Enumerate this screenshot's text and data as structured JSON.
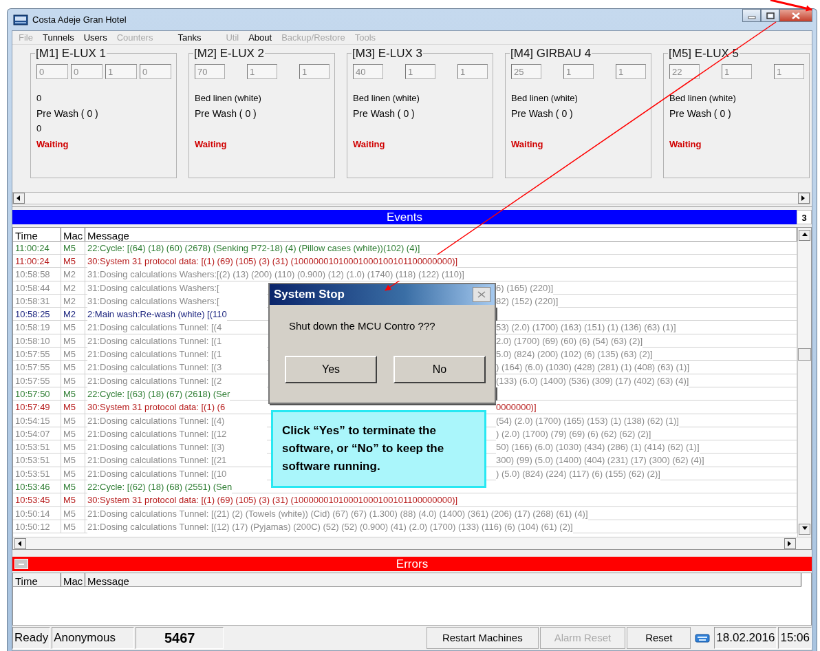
{
  "window": {
    "title": "Costa Adeje Gran Hotel"
  },
  "menu": [
    {
      "label": "File",
      "disabled": true
    },
    {
      "label": "Tunnels",
      "disabled": false
    },
    {
      "label": "Users",
      "disabled": false
    },
    {
      "label": "Counters",
      "disabled": true
    },
    {
      "label": "Tanks",
      "disabled": false
    },
    {
      "label": "Util",
      "disabled": true
    },
    {
      "label": "About",
      "disabled": false
    },
    {
      "label": "Backup/Restore",
      "disabled": true
    },
    {
      "label": "Tools",
      "disabled": true
    }
  ],
  "machines": [
    {
      "title": "[M1] E-LUX 1",
      "inputs": [
        "0",
        "0",
        "1",
        "0"
      ],
      "lines": [
        "0",
        "Pre Wash ( 0 )",
        "0"
      ],
      "status": "Waiting"
    },
    {
      "title": "[M2] E-LUX 2",
      "inputs": [
        "70",
        "1",
        "1"
      ],
      "lines": [
        "Bed linen (white)",
        "Pre Wash ( 0 )"
      ],
      "status": "Waiting"
    },
    {
      "title": "[M3] E-LUX 3",
      "inputs": [
        "40",
        "1",
        "1"
      ],
      "lines": [
        "Bed linen (white)",
        "Pre Wash ( 0 )"
      ],
      "status": "Waiting"
    },
    {
      "title": "[M4] GIRBAU 4",
      "inputs": [
        "25",
        "1",
        "1"
      ],
      "lines": [
        "Bed linen (white)",
        "Pre Wash ( 0 )"
      ],
      "status": "Waiting"
    },
    {
      "title": "[M5] E-LUX 5",
      "inputs": [
        "22",
        "1",
        "1"
      ],
      "lines": [
        "Bed linen (white)",
        "Pre Wash ( 0 )"
      ],
      "status": "Waiting"
    }
  ],
  "events": {
    "title": "Events",
    "count": "3",
    "columns": [
      "Time",
      "Mac",
      "Message"
    ],
    "rows": [
      {
        "time": "11:00:24",
        "machine": "M5",
        "message": "22:Cycle: [(64) (18) (60) (2678) (Senking P72-18) (4) (Pillow cases (white))(102) (4)]",
        "color": "#2e7d32"
      },
      {
        "time": "11:00:24",
        "machine": "M5",
        "message": "30:System 31 protocol data: [(1) (69) (105) (3) (31) (10000001010001000100101100000000)]",
        "color": "#b71c1c"
      },
      {
        "time": "10:58:58",
        "machine": "M2",
        "message": "31:Dosing calculations Washers:[(2) (13) (200) (110) (0.900) (12) (1.0) (1740) (118) (122) (110)]",
        "color": "#8a8a8a"
      },
      {
        "time": "10:58:44",
        "machine": "M2",
        "message": "31:Dosing calculations Washers:[",
        "message_tail": "6) (165) (220)]",
        "color": "#8a8a8a"
      },
      {
        "time": "10:58:31",
        "machine": "M2",
        "message": "31:Dosing calculations Washers:[",
        "message_tail": "82) (152) (220)]",
        "color": "#8a8a8a"
      },
      {
        "time": "10:58:25",
        "machine": "M2",
        "message": "2:Main wash:Re-wash (white) [(110",
        "color": "#1a237e"
      },
      {
        "time": "10:58:19",
        "machine": "M5",
        "message": "21:Dosing calculations Tunnel: [(4",
        "message_tail": "53) (2.0) (1700) (163) (151) (1) (136) (63) (1)]",
        "color": "#8a8a8a"
      },
      {
        "time": "10:58:10",
        "machine": "M5",
        "message": "21:Dosing calculations Tunnel: [(1",
        "message_tail": "2.0) (1700) (69) (60) (6) (54) (63) (2)]",
        "color": "#8a8a8a"
      },
      {
        "time": "10:57:55",
        "machine": "M5",
        "message": "21:Dosing calculations Tunnel: [(1",
        "message_tail": "5.0) (824) (200) (102) (6) (135) (63) (2)]",
        "color": "#8a8a8a"
      },
      {
        "time": "10:57:55",
        "machine": "M5",
        "message": "21:Dosing calculations Tunnel: [(3",
        "message_tail": ") (164) (6.0) (1030) (428) (281) (1) (408) (63) (1)]",
        "color": "#8a8a8a"
      },
      {
        "time": "10:57:55",
        "machine": "M5",
        "message": "21:Dosing calculations Tunnel: [(2",
        "message_tail": "(133) (6.0) (1400) (536) (309) (17) (402) (63) (4)]",
        "color": "#8a8a8a"
      },
      {
        "time": "10:57:50",
        "machine": "M5",
        "message": "22:Cycle: [(63) (18) (67) (2618) (Ser",
        "color": "#2e7d32"
      },
      {
        "time": "10:57:49",
        "machine": "M5",
        "message": "30:System 31 protocol data: [(1) (6",
        "message_tail": "0000000)]",
        "color": "#b71c1c"
      },
      {
        "time": "10:54:15",
        "machine": "M5",
        "message": "21:Dosing calculations Tunnel: [(4)",
        "message_tail": "(54) (2.0) (1700) (165) (153) (1) (138) (62) (1)]",
        "color": "#8a8a8a"
      },
      {
        "time": "10:54:07",
        "machine": "M5",
        "message": "21:Dosing calculations Tunnel: [(12",
        "message_tail": ") (2.0) (1700) (79) (69) (6) (62) (62) (2)]",
        "color": "#8a8a8a"
      },
      {
        "time": "10:53:51",
        "machine": "M5",
        "message": "21:Dosing calculations Tunnel: [(3)",
        "message_tail": "50) (166) (6.0) (1030) (434) (286) (1) (414) (62) (1)]",
        "color": "#8a8a8a"
      },
      {
        "time": "10:53:51",
        "machine": "M5",
        "message": "21:Dosing calculations Tunnel: [(21",
        "message_tail": "300) (99) (5.0) (1400) (404) (231) (17) (300) (62) (4)]",
        "color": "#8a8a8a"
      },
      {
        "time": "10:53:51",
        "machine": "M5",
        "message": "21:Dosing calculations Tunnel: [(10",
        "message_tail": ") (5.0) (824) (224) (117) (6) (155) (62) (2)]",
        "color": "#8a8a8a"
      },
      {
        "time": "10:53:46",
        "machine": "M5",
        "message": "22:Cycle: [(62) (18) (68) (2551) (Sen",
        "color": "#2e7d32"
      },
      {
        "time": "10:53:45",
        "machine": "M5",
        "message": "30:System 31 protocol data: [(1) (69) (105) (3) (31) (10000001010001000100101100000000)]",
        "color": "#b71c1c"
      },
      {
        "time": "10:50:14",
        "machine": "M5",
        "message": "21:Dosing calculations Tunnel: [(21) (2) (Towels (white)) (Cid) (67) (67) (1.300) (88) (4.0) (1400) (361) (206) (17) (268) (61) (4)]",
        "color": "#8a8a8a"
      },
      {
        "time": "10:50:12",
        "machine": "M5",
        "message": "21:Dosing calculations Tunnel: [(12) (17) (Pyjamas) (200C) (52) (52) (0.900) (41) (2.0) (1700) (133) (116) (6) (104) (61) (2)]",
        "color": "#8a8a8a"
      }
    ]
  },
  "dialog": {
    "title": "System Stop",
    "message": "Shut down the MCU Contro ???",
    "buttons": [
      "Yes",
      "No"
    ]
  },
  "callout": {
    "text": "Click “Yes” to terminate the software, or “No” to keep the software running."
  },
  "errors": {
    "title": "Errors",
    "columns": [
      "Time",
      "Mac",
      "Message"
    ]
  },
  "status_bar": {
    "state": "Ready",
    "user": "Anonymous",
    "counter": "5467",
    "buttons": [
      {
        "label": "Restart Machines",
        "disabled": false
      },
      {
        "label": "Alarm Reset",
        "disabled": true
      },
      {
        "label": "Reset",
        "disabled": false
      }
    ],
    "date": "18.02.2016",
    "time": "15:06"
  }
}
